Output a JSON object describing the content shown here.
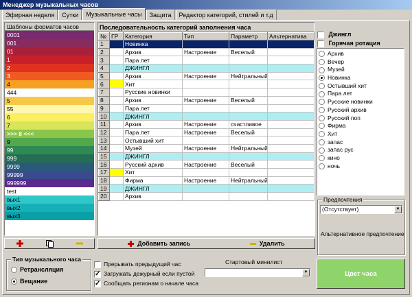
{
  "window": {
    "title": "Менеджер музыкальных часов"
  },
  "tabs": [
    {
      "label": "Эфирная неделя",
      "active": false
    },
    {
      "label": "Сутки",
      "active": false
    },
    {
      "label": "Музыкальные часы",
      "active": true
    },
    {
      "label": "Защита",
      "active": false
    },
    {
      "label": "Редактор категорий, стилей и т.д",
      "active": false
    }
  ],
  "templates": {
    "header": "Шаблоны форматов часов",
    "items": [
      {
        "label": "0001",
        "bg": "#7a2a6e",
        "fg": "#ffffff"
      },
      {
        "label": "001",
        "bg": "#8a2b5e",
        "fg": "#ffffff"
      },
      {
        "label": "01",
        "bg": "#a8203a",
        "fg": "#ffffff"
      },
      {
        "label": "1",
        "bg": "#c8202a",
        "fg": "#ffffff"
      },
      {
        "label": "2",
        "bg": "#e03020",
        "fg": "#ffffff"
      },
      {
        "label": "3",
        "bg": "#f05a22",
        "fg": "#ffffff"
      },
      {
        "label": "4",
        "bg": "#f5a020",
        "fg": "#000000"
      },
      {
        "label": "444",
        "bg": "#ffffff",
        "fg": "#000000"
      },
      {
        "label": "5",
        "bg": "#f6c848",
        "fg": "#000000"
      },
      {
        "label": "55",
        "bg": "#fff6b0",
        "fg": "#000000"
      },
      {
        "label": "6",
        "bg": "#f9ef60",
        "fg": "#000000"
      },
      {
        "label": "7",
        "bg": "#d8e45a",
        "fg": "#000000"
      },
      {
        "label": ">>> 8 <<<",
        "bg": "#8ac64a",
        "fg": "#ffffff"
      },
      {
        "label": "9",
        "bg": "#52a84a",
        "fg": "#000000"
      },
      {
        "label": "99",
        "bg": "#2e8a52",
        "fg": "#ffffff"
      },
      {
        "label": "999",
        "bg": "#256e54",
        "fg": "#ffffff"
      },
      {
        "label": "9999",
        "bg": "#2a5a7a",
        "fg": "#ffffff"
      },
      {
        "label": "99999",
        "bg": "#3a4a8e",
        "fg": "#ffffff"
      },
      {
        "label": "999999",
        "bg": "#5a2a8e",
        "fg": "#ffffff"
      },
      {
        "label": "test",
        "bg": "#ffffff",
        "fg": "#000000"
      },
      {
        "label": "вых1",
        "bg": "#2ec8c8",
        "fg": "#000000"
      },
      {
        "label": "вых2",
        "bg": "#18b0b8",
        "fg": "#000000"
      },
      {
        "label": "вых3",
        "bg": "#0aa0a8",
        "fg": "#000000"
      }
    ]
  },
  "grid": {
    "title": "Последовательность категорий заполнения часа",
    "columns": [
      "№",
      "ГР",
      "Категория",
      "Тип",
      "Параметр",
      "Альтернатива"
    ],
    "rows": [
      {
        "n": "1",
        "gr": "",
        "cat": "Новинка",
        "type": "",
        "param": "",
        "alt": "",
        "style": "sel"
      },
      {
        "n": "2",
        "gr": "",
        "cat": "Архив",
        "type": "Настроение",
        "param": "Веселый",
        "alt": "",
        "style": ""
      },
      {
        "n": "3",
        "gr": "",
        "cat": "Пара лет",
        "type": "",
        "param": "",
        "alt": "",
        "style": ""
      },
      {
        "n": "4",
        "gr": "",
        "cat": "ДЖИНГЛ",
        "type": "",
        "param": "",
        "alt": "",
        "style": "jingle"
      },
      {
        "n": "5",
        "gr": "",
        "cat": "Архив",
        "type": "Настроение",
        "param": "Нейтральный",
        "alt": "",
        "style": ""
      },
      {
        "n": "6",
        "gr": "yellow",
        "cat": "Хит",
        "type": "",
        "param": "",
        "alt": "",
        "style": ""
      },
      {
        "n": "7",
        "gr": "",
        "cat": "Русские новинки",
        "type": "",
        "param": "",
        "alt": "",
        "style": ""
      },
      {
        "n": "8",
        "gr": "",
        "cat": "Архив",
        "type": "Настроение",
        "param": "Веселый",
        "alt": "",
        "style": ""
      },
      {
        "n": "9",
        "gr": "",
        "cat": "Пара лет",
        "type": "",
        "param": "",
        "alt": "",
        "style": ""
      },
      {
        "n": "10",
        "gr": "",
        "cat": "ДЖИНГЛ",
        "type": "",
        "param": "",
        "alt": "",
        "style": "jingle"
      },
      {
        "n": "11",
        "gr": "",
        "cat": "Архив",
        "type": "Настроение",
        "param": "счастливое",
        "alt": "",
        "style": ""
      },
      {
        "n": "12",
        "gr": "",
        "cat": "Пара лет",
        "type": "Настроение",
        "param": "Веселый",
        "alt": "",
        "style": ""
      },
      {
        "n": "13",
        "gr": "",
        "cat": "Остывший хит",
        "type": "",
        "param": "",
        "alt": "",
        "style": ""
      },
      {
        "n": "14",
        "gr": "",
        "cat": "Музей",
        "type": "Настроение",
        "param": "Нейтральный",
        "alt": "",
        "style": ""
      },
      {
        "n": "15",
        "gr": "",
        "cat": "ДЖИНГЛ",
        "type": "",
        "param": "",
        "alt": "",
        "style": "jingle"
      },
      {
        "n": "16",
        "gr": "",
        "cat": "Русский архив",
        "type": "Настроение",
        "param": "Веселый",
        "alt": "",
        "style": ""
      },
      {
        "n": "17",
        "gr": "yellow",
        "cat": "Хит",
        "type": "",
        "param": "",
        "alt": "",
        "style": ""
      },
      {
        "n": "18",
        "gr": "",
        "cat": "Фирма",
        "type": "Настроение",
        "param": "Нейтральный",
        "alt": "",
        "style": ""
      },
      {
        "n": "19",
        "gr": "",
        "cat": "ДЖИНГЛ",
        "type": "",
        "param": "",
        "alt": "",
        "style": "jingle"
      },
      {
        "n": "20",
        "gr": "",
        "cat": "Архив",
        "type": "",
        "param": "",
        "alt": "",
        "style": ""
      }
    ]
  },
  "buttons": {
    "add_record": "Добавить запись",
    "delete": "Удалить"
  },
  "right": {
    "jingle_label": "Джингл",
    "jingle_checked": false,
    "hot_rotation_label": "Горячая ротация",
    "hot_rotation_checked": false,
    "categories": [
      "Архив",
      "Вечер",
      "Музей",
      "Новинка",
      "Остывший хит",
      "Пара лет",
      "Русские новинки",
      "Русский архив",
      "Русский поп",
      "Фирма",
      "Хит",
      "запас",
      "запас рус",
      "кино",
      "ночь"
    ],
    "selected_category": "Новинка",
    "preference_label": "Предпочтения",
    "preference_value": "(Отсутствует)",
    "alt_preference_label": "Альтернативное предпочтение"
  },
  "bottom": {
    "hour_type_label": "Тип музыкального часа",
    "retranslation_label": "Ретрансляция",
    "broadcast_label": "Вещание",
    "selected_type": "broadcast",
    "options": [
      {
        "label": "Прерывать предыдущий час",
        "checked": false
      },
      {
        "label": "Загружать дежурный если пустой",
        "checked": true
      },
      {
        "label": "Сообщать регионам о начале часа",
        "checked": true
      }
    ],
    "start_minilist_label": "Стартовый минилист",
    "start_minilist_value": "",
    "hour_color_label": "Цвет часа",
    "hour_color": "#8fd46a"
  }
}
